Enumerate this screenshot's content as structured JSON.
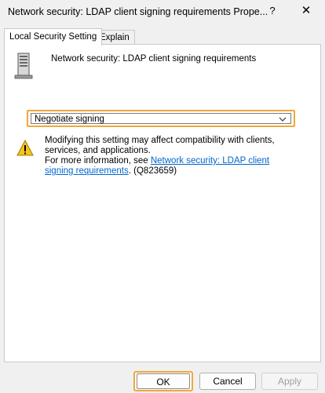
{
  "window": {
    "title": "Network security: LDAP client signing requirements Prope...",
    "help_label": "?",
    "close_label": "✕"
  },
  "tabs": [
    {
      "label": "Local Security Setting"
    },
    {
      "label": "Explain"
    }
  ],
  "policy": {
    "name": "Network security: LDAP client signing requirements",
    "icon": "server-icon"
  },
  "setting": {
    "selected_value": "Negotiate signing",
    "highlight_color": "#f2a73a"
  },
  "warning": {
    "icon": "warning-icon",
    "line1": "Modifying this setting may affect compatibility with clients, services, and applications.",
    "more_info_prefix": "For more information, see ",
    "link_text": "Network security: LDAP client signing requirements",
    "suffix": ". (Q823659)",
    "link_color": "#0066cc"
  },
  "buttons": {
    "ok": "OK",
    "cancel": "Cancel",
    "apply": "Apply"
  }
}
